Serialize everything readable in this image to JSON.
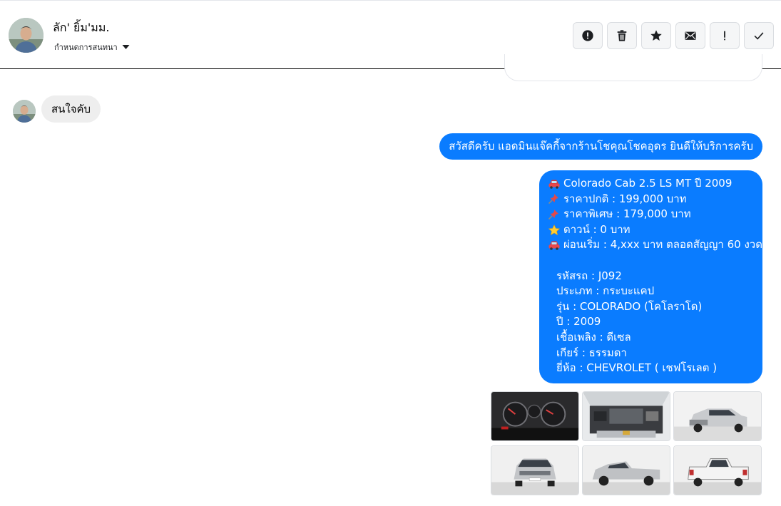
{
  "header": {
    "contact_name": "ลัก' ยิ้ม'มม.",
    "subtitle": "กำหนดการสนทนา",
    "actions": [
      {
        "icon": "alert-circle-icon",
        "name": "report-button"
      },
      {
        "icon": "trash-icon",
        "name": "delete-button"
      },
      {
        "icon": "star-icon",
        "name": "star-button"
      },
      {
        "icon": "envelope-icon",
        "name": "mark-unread-button"
      },
      {
        "icon": "exclamation-icon",
        "name": "spam-button"
      },
      {
        "icon": "check-icon",
        "name": "done-button"
      }
    ]
  },
  "messages": {
    "incoming": "สนใจคับ",
    "greeting": "สวัสดีครับ แอดมินแจ๊คกี้จากร้านโชคุณโชคอุดร ยินดีให้บริการครับ",
    "details": {
      "lines": [
        {
          "emoji": "car-icon",
          "text": "Colorado Cab 2.5 LS MT ปี 2009"
        },
        {
          "emoji": "pushpin-icon",
          "text": "ราคาปกติ : 199,000 บาท"
        },
        {
          "emoji": "pushpin-icon",
          "text": "ราคาพิเศษ : 179,000 บาท"
        },
        {
          "emoji": "star-emoji-icon",
          "text": "ดาวน์ : 0 บาท"
        },
        {
          "emoji": "car-icon",
          "text": "ผ่อนเริ่ม : 4,xxx บาท ตลอดสัญญา 60 งวด"
        }
      ],
      "specs": [
        "รหัสรถ : J092",
        "ประเภท : กระบะแคป",
        "รุ่น : COLORADO (โคโลราโด)",
        "ปี : 2009",
        "เชื้อเพลิง : ดีเซล",
        "เกียร์ : ธรรมดา",
        "ยี่ห้อ : CHEVROLET ( เชฟโรเลต )"
      ]
    }
  },
  "colors": {
    "accent": "#0a7cff",
    "incoming_bubble": "#eeeeee"
  }
}
